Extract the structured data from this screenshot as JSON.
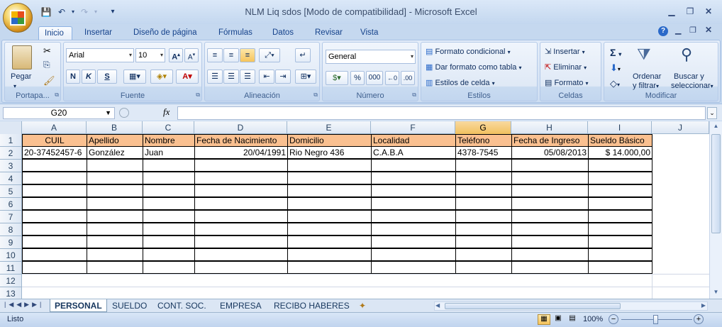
{
  "window": {
    "title": "NLM Liq sdos  [Modo de compatibilidad] - Microsoft Excel"
  },
  "ribbon_tabs": [
    "Inicio",
    "Insertar",
    "Diseño de página",
    "Fórmulas",
    "Datos",
    "Revisar",
    "Vista"
  ],
  "ribbon": {
    "portapapeles": {
      "label": "Portapa...",
      "pegar": "Pegar"
    },
    "fuente": {
      "label": "Fuente",
      "font": "Arial",
      "size": "10",
      "bold": "N",
      "italic": "K",
      "underline": "S"
    },
    "alineacion": {
      "label": "Alineación"
    },
    "numero": {
      "label": "Número",
      "format": "General",
      "percent": "%",
      "thousands": "000"
    },
    "estilos": {
      "label": "Estilos",
      "formato_condicional": "Formato condicional",
      "dar_formato": "Dar formato como tabla",
      "estilos_celda": "Estilos de celda"
    },
    "celdas": {
      "label": "Celdas",
      "insertar": "Insertar",
      "eliminar": "Eliminar",
      "formato": "Formato"
    },
    "modificar": {
      "label": "Modificar",
      "ordenar1": "Ordenar",
      "ordenar2": "y filtrar",
      "buscar1": "Buscar y",
      "buscar2": "seleccionar"
    }
  },
  "formula_bar": {
    "name_box": "G20",
    "fx": "fx",
    "formula": ""
  },
  "columns": [
    "A",
    "B",
    "C",
    "D",
    "E",
    "F",
    "G",
    "H",
    "I",
    "J"
  ],
  "selected_column": "G",
  "rows": [
    "1",
    "2",
    "3",
    "4",
    "5",
    "6",
    "7",
    "8",
    "9",
    "10",
    "11",
    "12",
    "13"
  ],
  "table": {
    "headers": [
      "CUIL",
      "Apellido",
      "Nombre",
      "Fecha de Nacimiento",
      "Domicilio",
      "Localidad",
      "Teléfono",
      "Fecha de Ingreso",
      "Sueldo Básico"
    ],
    "record": [
      "20-37452457-6",
      "González",
      "Juan",
      "20/04/1991",
      "Rio Negro 436",
      "C.A.B.A",
      "4378-7545",
      "05/08/2013",
      "$ 14.000,00"
    ]
  },
  "sheets": [
    "PERSONAL",
    "SUELDO",
    "CONT. SOC.",
    "EMPRESA",
    "RECIBO HABERES"
  ],
  "active_sheet": "PERSONAL",
  "status": {
    "ready": "Listo",
    "zoom": "100%"
  }
}
